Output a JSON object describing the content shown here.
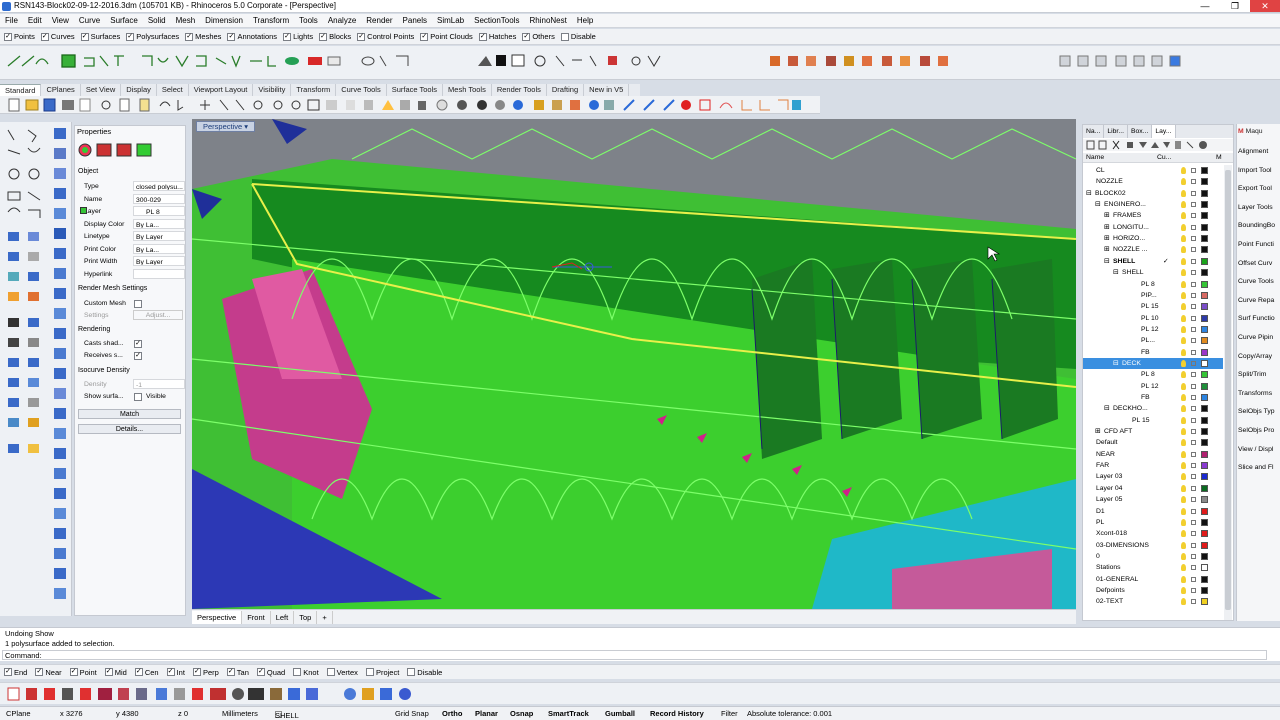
{
  "window": {
    "title": "RSN143-Block02-09-12-2016.3dm (105701 KB) - Rhinoceros 5.0 Corporate - [Perspective]",
    "controls": [
      "—",
      "❐",
      "✕"
    ]
  },
  "menu": [
    "File",
    "Edit",
    "View",
    "Curve",
    "Surface",
    "Solid",
    "Mesh",
    "Dimension",
    "Transform",
    "Tools",
    "Analyze",
    "Render",
    "Panels",
    "SimLab",
    "SectionTools",
    "RhinoNest",
    "Help"
  ],
  "selection_filters": [
    {
      "label": "Points",
      "checked": true
    },
    {
      "label": "Curves",
      "checked": true
    },
    {
      "label": "Surfaces",
      "checked": true
    },
    {
      "label": "Polysurfaces",
      "checked": true
    },
    {
      "label": "Meshes",
      "checked": true
    },
    {
      "label": "Annotations",
      "checked": true
    },
    {
      "label": "Lights",
      "checked": true
    },
    {
      "label": "Blocks",
      "checked": true
    },
    {
      "label": "Control Points",
      "checked": true
    },
    {
      "label": "Point Clouds",
      "checked": true
    },
    {
      "label": "Hatches",
      "checked": true
    },
    {
      "label": "Others",
      "checked": true
    },
    {
      "label": "Disable",
      "checked": false
    }
  ],
  "toolbar_tabs": [
    "Standard",
    "CPlanes",
    "Set View",
    "Display",
    "Select",
    "Viewport Layout",
    "Visibility",
    "Transform",
    "Curve Tools",
    "Surface Tools",
    "Mesh Tools",
    "Render Tools",
    "Drafting",
    "New in V5"
  ],
  "properties": {
    "title": "Properties",
    "section_object": "Object",
    "rows": [
      {
        "key": "Type",
        "value": "closed polysu..."
      },
      {
        "key": "Name",
        "value": "300-029"
      },
      {
        "key": "Layer",
        "value": "PL 8"
      },
      {
        "key": "Display Color",
        "value": "By La..."
      },
      {
        "key": "Linetype",
        "value": "By Layer"
      },
      {
        "key": "Print Color",
        "value": "By La..."
      },
      {
        "key": "Print Width",
        "value": "By Layer"
      },
      {
        "key": "Hyperlink",
        "value": ""
      }
    ],
    "section_render_mesh": "Render Mesh Settings",
    "custom_mesh": "Custom Mesh",
    "settings": "Settings",
    "adjust": "Adjust...",
    "section_rendering": "Rendering",
    "casts_shadows": "Casts shad...",
    "receives_shadows": "Receives s...",
    "section_isocurve": "Isocurve Density",
    "density": "Density",
    "density_value": "-1",
    "show_surface": "Show surfa...",
    "visible": "Visible",
    "match_button": "Match",
    "details_button": "Details..."
  },
  "viewport": {
    "label": "Perspective"
  },
  "view_tabs": [
    "Perspective",
    "Front",
    "Left",
    "Top",
    "+"
  ],
  "layers_panel": {
    "tabs": [
      "Na...",
      "Libr...",
      "Box...",
      "Lay..."
    ],
    "col_name": "Name",
    "col_cur": "Cu...",
    "col_m": "M",
    "rows": [
      {
        "name": "CL",
        "indent": 0,
        "color": "#111111"
      },
      {
        "name": "NOZZLE",
        "indent": 0,
        "color": "#111111"
      },
      {
        "name": "BLOCK02",
        "indent": 0,
        "expand": "⊟",
        "color": "#111111"
      },
      {
        "name": "ENGINERO...",
        "indent": 1,
        "expand": "⊟",
        "color": "#111111"
      },
      {
        "name": "FRAMES",
        "indent": 2,
        "expand": "⊞",
        "color": "#111111"
      },
      {
        "name": "LONGITU...",
        "indent": 2,
        "expand": "⊞",
        "color": "#111111"
      },
      {
        "name": "HORIZO...",
        "indent": 2,
        "expand": "⊞",
        "color": "#111111"
      },
      {
        "name": "NOZZLE ...",
        "indent": 2,
        "expand": "⊞",
        "color": "#111111"
      },
      {
        "name": "SHELL",
        "indent": 2,
        "expand": "⊟",
        "color": "#1aa31a",
        "bold": true,
        "current": "✓"
      },
      {
        "name": "SHELL",
        "indent": 3,
        "expand": "⊟",
        "color": "#111111"
      },
      {
        "name": "PL 8",
        "indent": 5,
        "color": "#36c436"
      },
      {
        "name": "PIP...",
        "indent": 5,
        "color": "#d86a64"
      },
      {
        "name": "PL 15",
        "indent": 5,
        "color": "#7a4ec8"
      },
      {
        "name": "PL 10",
        "indent": 5,
        "color": "#2e3aa8"
      },
      {
        "name": "PL 12",
        "indent": 5,
        "color": "#2d84e0"
      },
      {
        "name": "PL...",
        "indent": 5,
        "color": "#e08b20"
      },
      {
        "name": "FB",
        "indent": 5,
        "color": "#9a36c8"
      },
      {
        "name": "DECK",
        "indent": 3,
        "expand": "⊟",
        "color": "#ffffff",
        "selected": true
      },
      {
        "name": "PL 8",
        "indent": 5,
        "color": "#36c436"
      },
      {
        "name": "PL 12",
        "indent": 5,
        "color": "#1f8f3a"
      },
      {
        "name": "FB",
        "indent": 5,
        "color": "#2d84e0"
      },
      {
        "name": "DECKHO...",
        "indent": 2,
        "expand": "⊟",
        "color": "#111111"
      },
      {
        "name": "PL 15",
        "indent": 4,
        "color": "#111111"
      },
      {
        "name": "CFD AFT",
        "indent": 1,
        "expand": "⊞",
        "color": "#111111"
      },
      {
        "name": "Default",
        "indent": 0,
        "color": "#111111"
      },
      {
        "name": "NEAR",
        "indent": 0,
        "color": "#b02070"
      },
      {
        "name": "FAR",
        "indent": 0,
        "color": "#8a3ad0"
      },
      {
        "name": "Layer 03",
        "indent": 0,
        "color": "#1a2ad0"
      },
      {
        "name": "Layer 04",
        "indent": 0,
        "color": "#0a6a20"
      },
      {
        "name": "Layer 05",
        "indent": 0,
        "color": "#8a8a8a"
      },
      {
        "name": "D1",
        "indent": 0,
        "color": "#e01a1a"
      },
      {
        "name": "PL",
        "indent": 0,
        "color": "#111111"
      },
      {
        "name": "Xcont-018",
        "indent": 0,
        "color": "#e01a1a"
      },
      {
        "name": "03-DIMENSIONS",
        "indent": 0,
        "color": "#e01a1a"
      },
      {
        "name": "0",
        "indent": 0,
        "color": "#111111"
      },
      {
        "name": "Stations",
        "indent": 0,
        "color": "#ffffff"
      },
      {
        "name": "01-GENERAL",
        "indent": 0,
        "color": "#111111"
      },
      {
        "name": "Defpoints",
        "indent": 0,
        "color": "#111111"
      },
      {
        "name": "02-TEXT",
        "indent": 0,
        "color": "#f0d020"
      }
    ]
  },
  "right_panel": {
    "header": "Maqu",
    "items": [
      "Alignment",
      "Import Tool",
      "Export Tool",
      "Layer Tools",
      "BoundingBo",
      "Point Functi",
      "Offset Curv",
      "Curve Tools",
      "Curve Repa",
      "Surf Functio",
      "Curve Pipin",
      "Copy/Array",
      "Split/Trim",
      "Transforms",
      "SelObjs Typ",
      "SelObjs Pro",
      "View / Displ",
      "Slice and Fl"
    ]
  },
  "command_history": [
    "Undoing Show",
    "1 polysurface added to selection."
  ],
  "command_prompt": "Command:",
  "osnaps": [
    {
      "label": "End",
      "checked": true
    },
    {
      "label": "Near",
      "checked": true
    },
    {
      "label": "Point",
      "checked": true
    },
    {
      "label": "Mid",
      "checked": true
    },
    {
      "label": "Cen",
      "checked": true
    },
    {
      "label": "Int",
      "checked": true
    },
    {
      "label": "Perp",
      "checked": true
    },
    {
      "label": "Tan",
      "checked": true
    },
    {
      "label": "Quad",
      "checked": true
    },
    {
      "label": "Knot",
      "checked": false
    },
    {
      "label": "Vertex",
      "checked": false
    },
    {
      "label": "Project",
      "checked": false
    },
    {
      "label": "Disable",
      "checked": false
    }
  ],
  "status": {
    "cplane": "CPlane",
    "x": "x 3276",
    "y": "y 4380",
    "z": "z 0",
    "units": "Millimeters",
    "layer": "SHELL",
    "grid_snap": "Grid Snap",
    "ortho": "Ortho",
    "planar": "Planar",
    "osnap": "Osnap",
    "smarttrack": "SmartTrack",
    "gumball": "Gumball",
    "record_history": "Record History",
    "filter": "Filter",
    "tolerance": "Absolute tolerance: 0.001"
  },
  "colors": {
    "accent": "#3a8fe0",
    "viewport_bg": "#7e8289",
    "model_green": "#2fd12f",
    "model_magenta": "#c03a8a",
    "model_blue": "#2030b0"
  }
}
